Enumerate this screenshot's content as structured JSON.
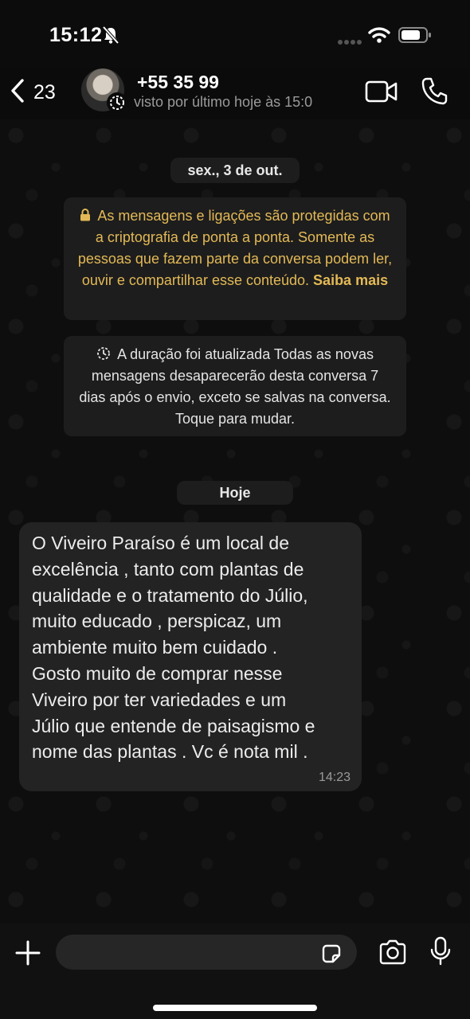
{
  "status_bar": {
    "time": "15:12",
    "icons": [
      "bell-slash-icon",
      "signal-icon",
      "wifi-icon",
      "battery-icon"
    ]
  },
  "header": {
    "back_count": "23",
    "contact_name": "+55 35 99",
    "contact_status": "visto por último hoje às 15:0",
    "icons": [
      "back-chevron-icon",
      "disappearing-timer-icon",
      "video-call-icon",
      "phone-icon"
    ]
  },
  "chat": {
    "date_separator": "sex., 3 de out.",
    "encryption_notice": {
      "text": "As mensagens e ligações são protegidas com a criptografia de ponta a ponta. Somente as pessoas que fazem parte da conversa podem ler, ouvir e compartilhar esse conteúdo.",
      "link": "Saiba mais"
    },
    "duration_notice": "A duração foi atualizada Todas as novas mensagens desaparecerão desta conversa 7 dias após o envio, exceto se salvas na conversa. Toque para mudar.",
    "today_separator": "Hoje",
    "messages": [
      {
        "text": "O Viveiro Paraíso é um local de\nexcelência , tanto com plantas de\nqualidade e o tratamento do Júlio,\nmuito educado , perspicaz,  um\nambiente muito bem cuidado .\nGosto muito de comprar nesse\nViveiro por ter variedades e um\nJúlio que entende de paisagismo e\nnome das plantas . Vc é nota mil .",
        "time": "14:23"
      }
    ]
  },
  "composer": {
    "placeholder": "",
    "icons": [
      "plus-icon",
      "sticker-icon",
      "camera-icon",
      "microphone-icon"
    ]
  },
  "colors": {
    "accent_notice": "#e3b956",
    "bubble": "#232323",
    "chip": "#1d1d1d",
    "background": "#0c0c0c"
  }
}
